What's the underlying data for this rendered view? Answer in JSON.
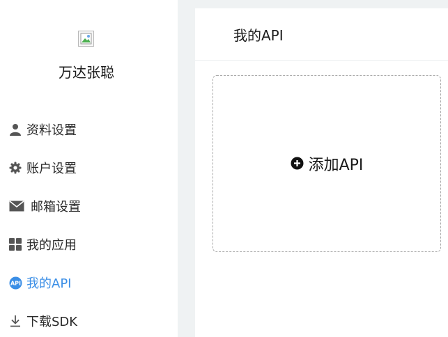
{
  "user": {
    "name": "万达张聪"
  },
  "sidebar": {
    "items": [
      {
        "label": "资料设置",
        "icon": "user-icon"
      },
      {
        "label": "账户设置",
        "icon": "gear-icon"
      },
      {
        "label": "邮箱设置",
        "icon": "envelope-icon"
      },
      {
        "label": "我的应用",
        "icon": "grid-icon"
      },
      {
        "label": "我的API",
        "icon": "api-icon",
        "active": true
      },
      {
        "label": "下载SDK",
        "icon": "download-icon"
      }
    ]
  },
  "main": {
    "title": "我的API",
    "add_label": "添加API",
    "add_icon": "plus-circle-icon"
  },
  "colors": {
    "accent": "#3a8ee6",
    "background": "#eff2f3"
  }
}
